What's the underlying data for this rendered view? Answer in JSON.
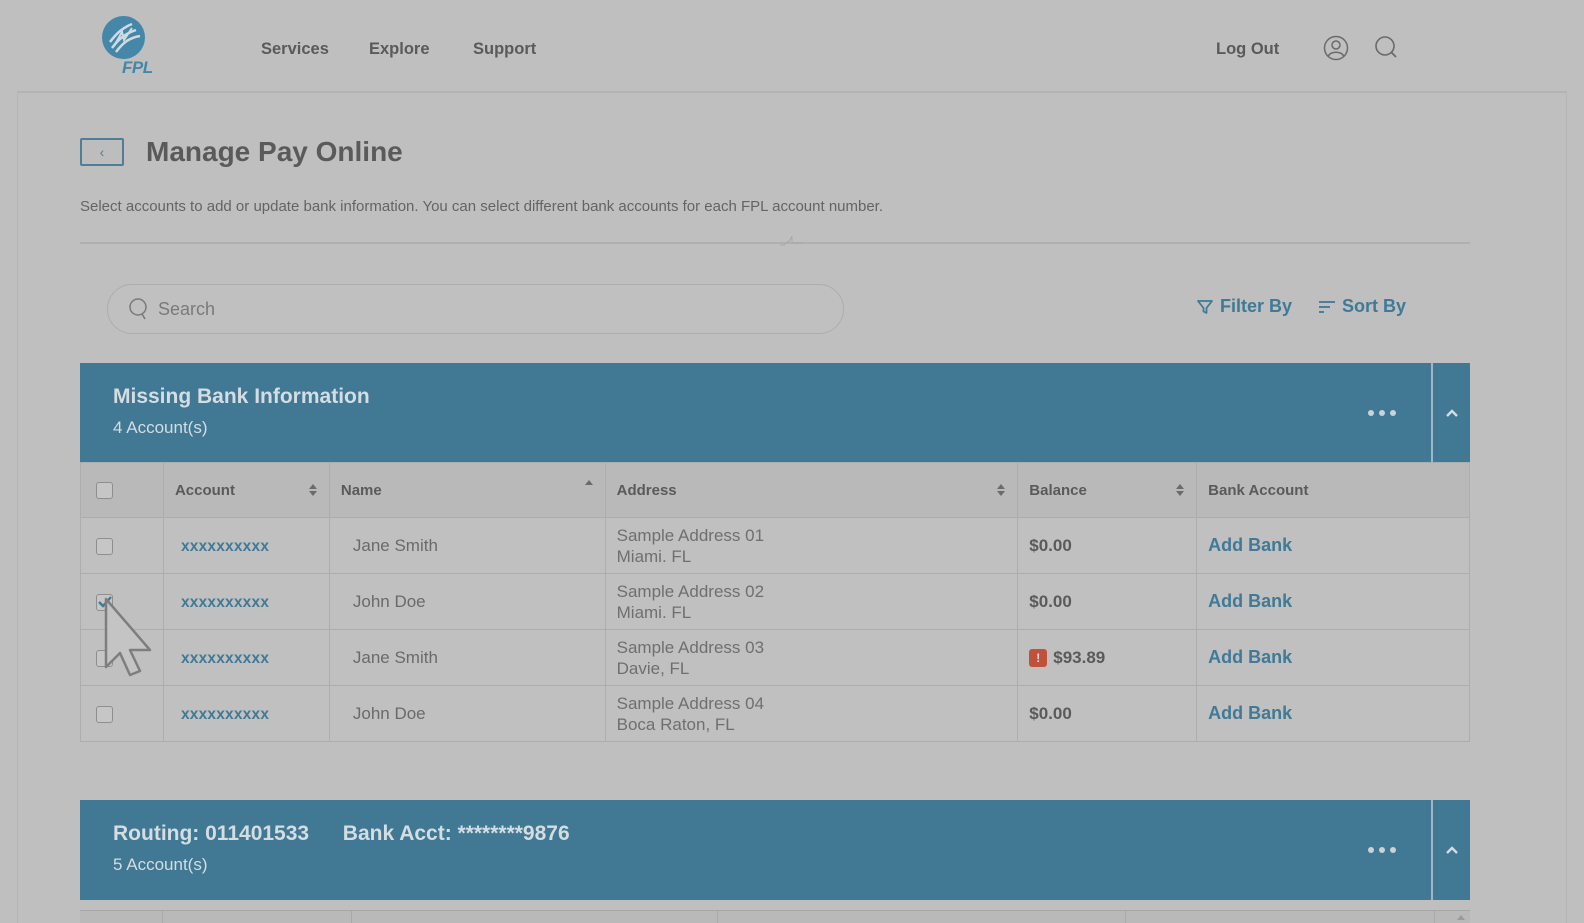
{
  "header": {
    "logo_text": "FPL",
    "nav": [
      {
        "label": "Services"
      },
      {
        "label": "Explore"
      },
      {
        "label": "Support"
      }
    ],
    "logout_label": "Log Out",
    "icons": {
      "account": "user-circle-icon",
      "search": "search-icon"
    }
  },
  "page": {
    "back_icon": "‹",
    "title": "Manage Pay Online",
    "subtitle": "Select accounts to add or update bank information. You can select different bank accounts for each FPL account number."
  },
  "toolbar": {
    "search_placeholder": "Search",
    "search_value": "",
    "filter_label": "Filter By",
    "sort_label": "Sort By"
  },
  "groups": [
    {
      "title": "Missing Bank Information",
      "count_label": "4 Account(s)",
      "columns": [
        {
          "label": "",
          "sort": "none"
        },
        {
          "label": "Account",
          "sort": "both"
        },
        {
          "label": "Name",
          "sort": "asc"
        },
        {
          "label": "Address",
          "sort": "both"
        },
        {
          "label": "Balance",
          "sort": "both"
        },
        {
          "label": "Bank Account",
          "sort": "none"
        }
      ],
      "select_all_checked": false,
      "rows": [
        {
          "checked": false,
          "account": "xxxxxxxxxx",
          "name": "Jane Smith",
          "address_line1": "Sample Address 01",
          "address_line2": "Miami. FL",
          "balance": "$0.00",
          "alert": false,
          "action": "Add Bank"
        },
        {
          "checked": true,
          "account": "xxxxxxxxxx",
          "name": "John Doe",
          "address_line1": "Sample Address 02",
          "address_line2": "Miami. FL",
          "balance": "$0.00",
          "alert": false,
          "action": "Add Bank"
        },
        {
          "checked": false,
          "account": "xxxxxxxxxx",
          "name": "Jane Smith",
          "address_line1": "Sample Address 03",
          "address_line2": "Davie, FL",
          "balance": "$93.89",
          "alert": true,
          "action": "Add Bank"
        },
        {
          "checked": false,
          "account": "xxxxxxxxxx",
          "name": "John Doe",
          "address_line1": "Sample Address 04",
          "address_line2": "Boca Raton, FL",
          "balance": "$0.00",
          "alert": false,
          "action": "Add Bank"
        }
      ]
    },
    {
      "title_routing": "Routing: 011401533",
      "title_bank": "Bank Acct: ********9876",
      "count_label": "5 Account(s)"
    }
  ],
  "alert_glyph": "!",
  "colors": {
    "brand": "#4487a8",
    "banner": "#417894",
    "link": "#3f7a96",
    "alert": "#c0523d",
    "overlay_bg": "#bfbfbf"
  }
}
